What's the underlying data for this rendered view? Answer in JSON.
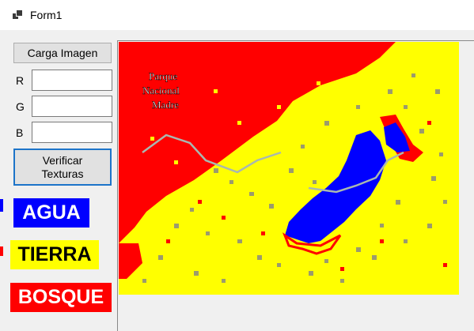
{
  "window": {
    "title": "Form1",
    "icon": "app-window-icon"
  },
  "controls": {
    "load_button": "Carga Imagen",
    "r_label": "R",
    "g_label": "G",
    "b_label": "B",
    "r_value": "",
    "g_value": "",
    "b_value": "",
    "verify_button": "Verificar\nTexturas"
  },
  "legend": [
    {
      "label": "AGUA",
      "bg": "#0000ff",
      "color": "#ffffff"
    },
    {
      "label": "TIERRA",
      "bg": "#ffff00",
      "color": "#000000"
    },
    {
      "label": "BOSQUE",
      "bg": "#ff0000",
      "color": "#ffffff"
    }
  ],
  "map": {
    "colors": {
      "water": "#0000ff",
      "land": "#ffff00",
      "forest": "#ff0000",
      "texture": "#8a8a80",
      "road": "#a9b8b0"
    },
    "overlay_text": [
      "Parque",
      "Nacional",
      "Madre"
    ]
  }
}
